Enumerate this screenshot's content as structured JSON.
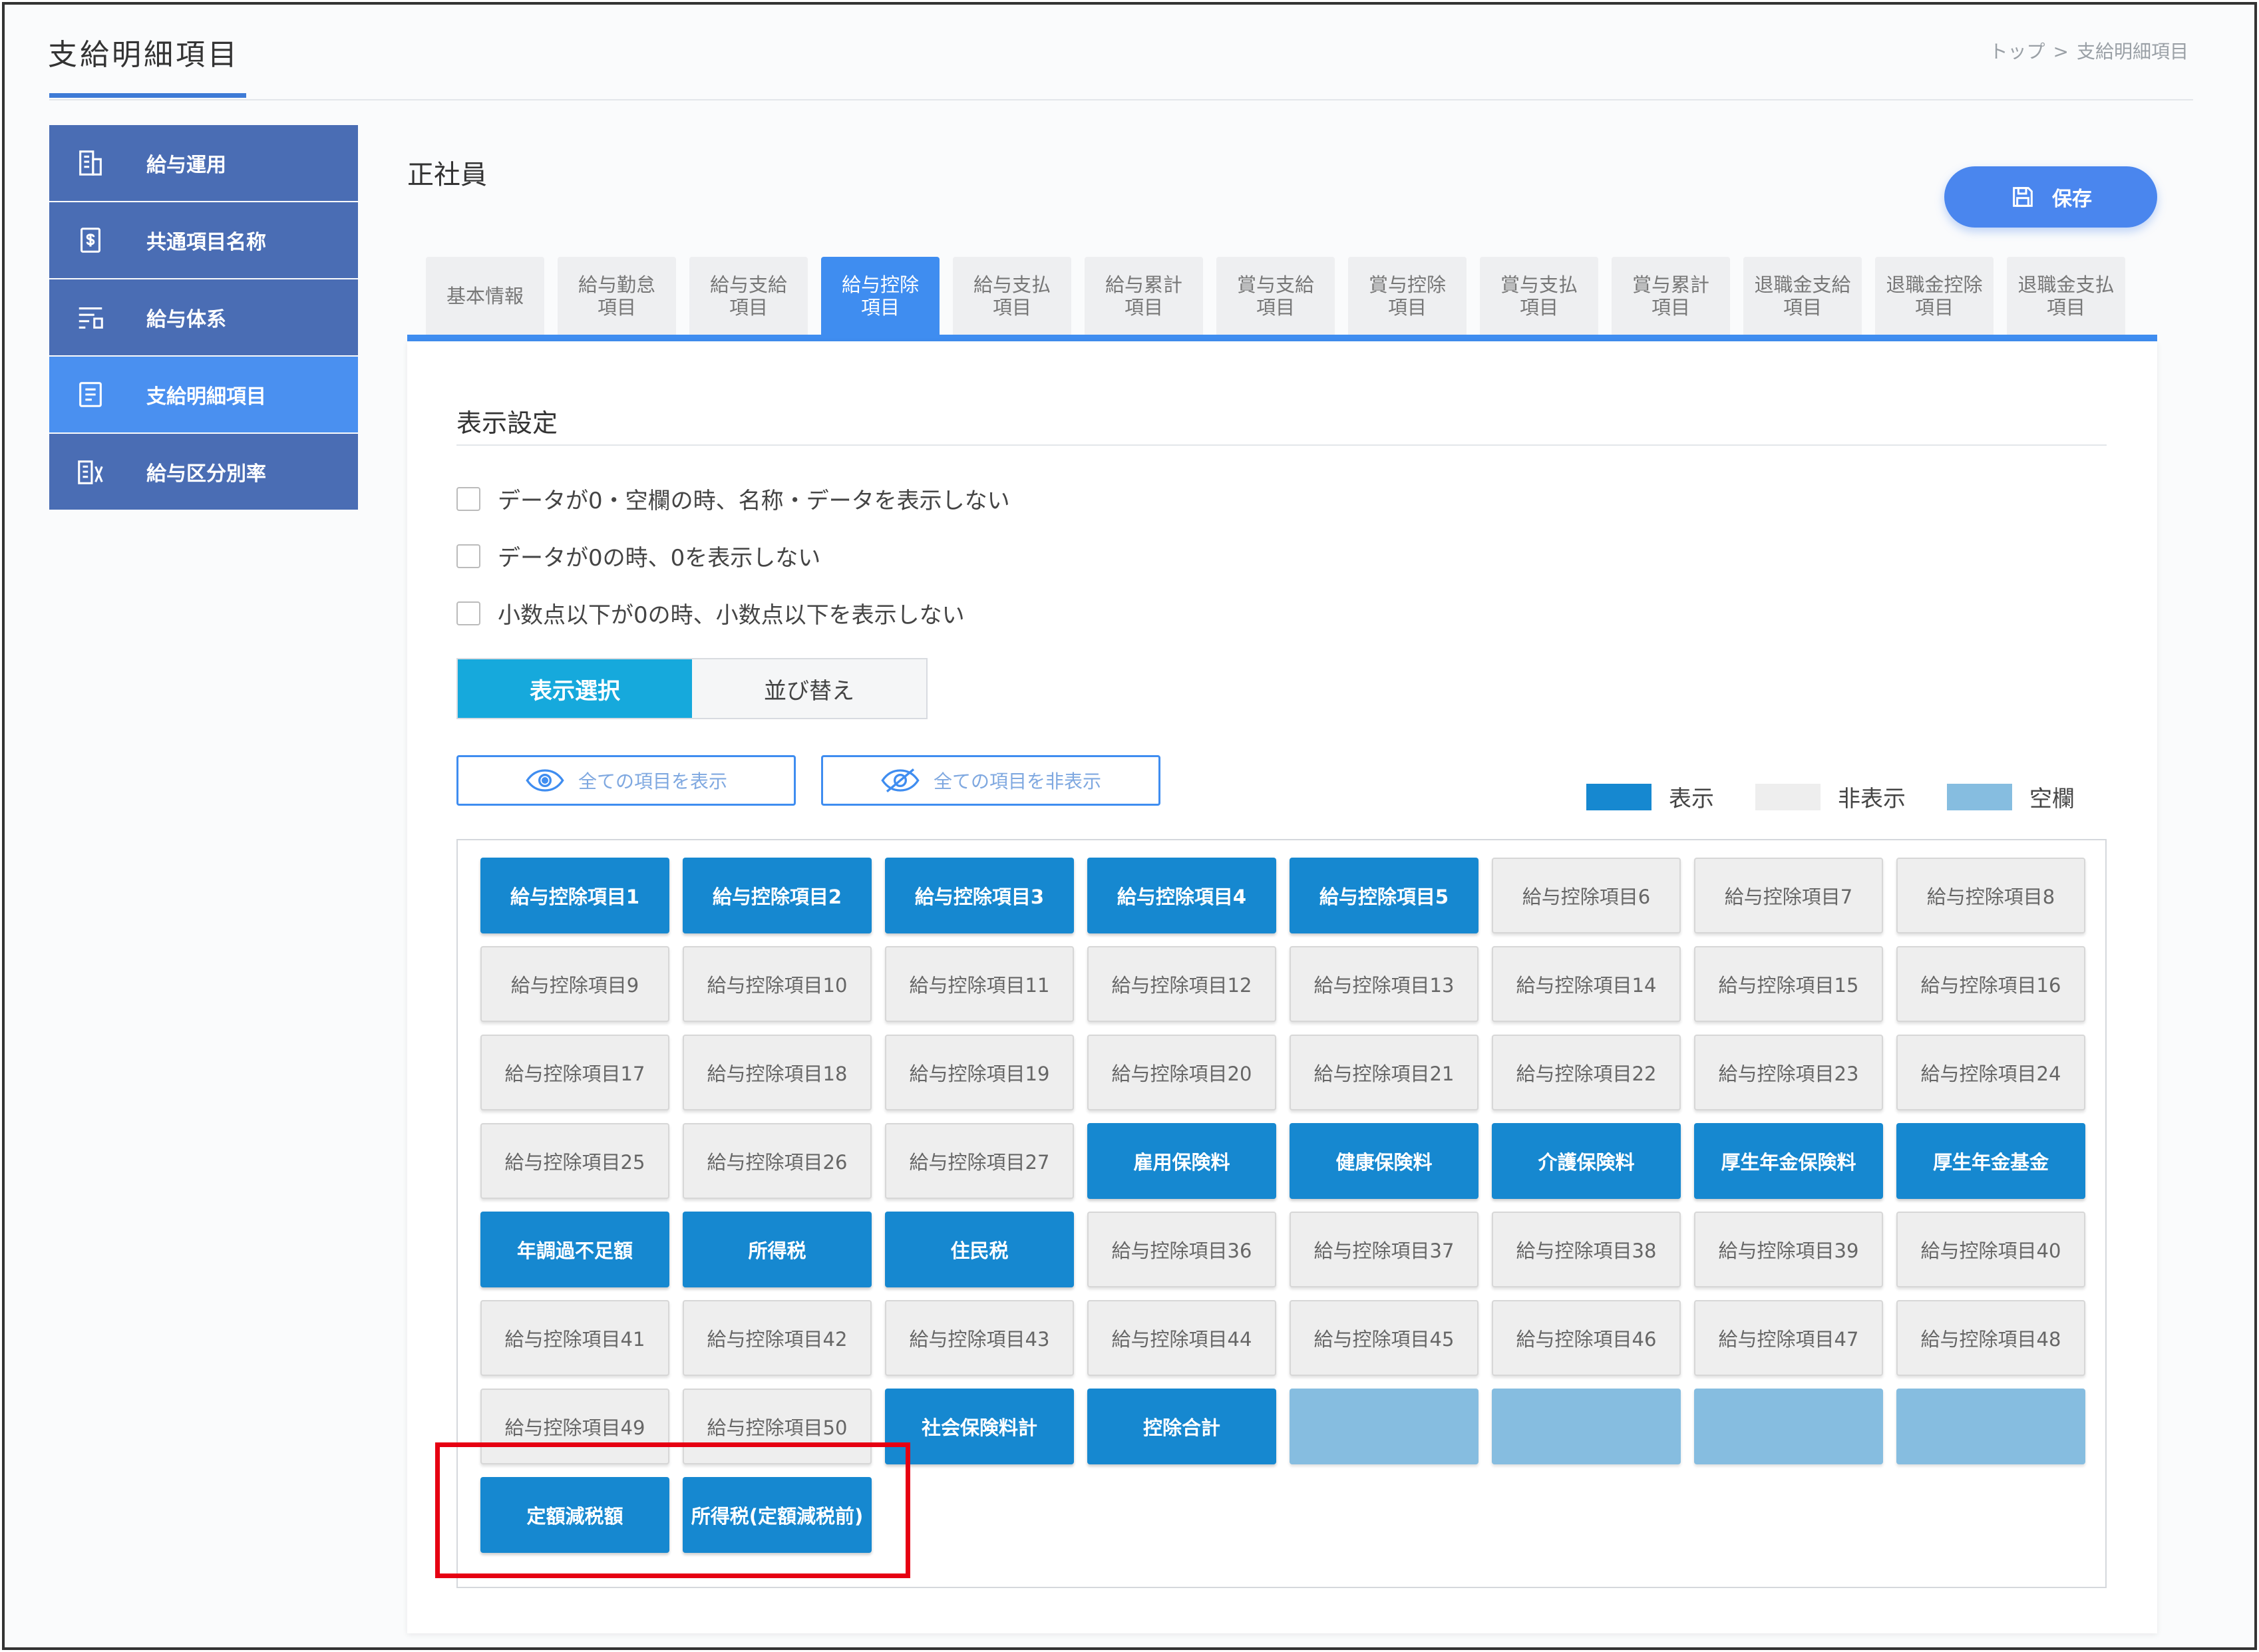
{
  "header": {
    "title": "支給明細項目",
    "breadcrumb": {
      "home": "トップ",
      "separator": ">",
      "current": "支給明細項目"
    }
  },
  "sidebar": {
    "items": [
      {
        "label": "給与運用",
        "icon": "building-icon"
      },
      {
        "label": "共通項目名称",
        "icon": "currency-document-icon"
      },
      {
        "label": "給与体系",
        "icon": "structure-icon"
      },
      {
        "label": "支給明細項目",
        "icon": "statement-icon",
        "active": true
      },
      {
        "label": "給与区分別率",
        "icon": "rate-building-icon"
      }
    ]
  },
  "main": {
    "employee_type": "正社員",
    "save_label": "保存",
    "tabs": [
      {
        "line1": "基本情報",
        "line2": ""
      },
      {
        "line1": "給与勤怠",
        "line2": "項目"
      },
      {
        "line1": "給与支給",
        "line2": "項目"
      },
      {
        "line1": "給与控除",
        "line2": "項目",
        "active": true
      },
      {
        "line1": "給与支払",
        "line2": "項目"
      },
      {
        "line1": "給与累計",
        "line2": "項目"
      },
      {
        "line1": "賞与支給",
        "line2": "項目"
      },
      {
        "line1": "賞与控除",
        "line2": "項目"
      },
      {
        "line1": "賞与支払",
        "line2": "項目"
      },
      {
        "line1": "賞与累計",
        "line2": "項目"
      },
      {
        "line1": "退職金支給",
        "line2": "項目"
      },
      {
        "line1": "退職金控除",
        "line2": "項目"
      },
      {
        "line1": "退職金支払",
        "line2": "項目"
      }
    ],
    "display_settings": {
      "title": "表示設定",
      "options": [
        {
          "label": "データが0・空欄の時、名称・データを表示しない",
          "checked": false
        },
        {
          "label": "データが0の時、0を表示しない",
          "checked": false
        },
        {
          "label": "小数点以下が0の時、小数点以下を表示しない",
          "checked": false
        }
      ]
    },
    "mode": {
      "select_label": "表示選択",
      "sort_label": "並び替え",
      "active": "表示選択"
    },
    "show_all_label": "全ての項目を表示",
    "hide_all_label": "全ての項目を非表示",
    "legend": [
      {
        "label": "表示",
        "color": "#1688d0"
      },
      {
        "label": "非表示",
        "color": "#eeeeee"
      },
      {
        "label": "空欄",
        "color": "#86bde0"
      }
    ],
    "items": [
      {
        "label": "給与控除項目1",
        "state": "show"
      },
      {
        "label": "給与控除項目2",
        "state": "show"
      },
      {
        "label": "給与控除項目3",
        "state": "show"
      },
      {
        "label": "給与控除項目4",
        "state": "show"
      },
      {
        "label": "給与控除項目5",
        "state": "show"
      },
      {
        "label": "給与控除項目6",
        "state": "hide"
      },
      {
        "label": "給与控除項目7",
        "state": "hide"
      },
      {
        "label": "給与控除項目8",
        "state": "hide"
      },
      {
        "label": "給与控除項目9",
        "state": "hide"
      },
      {
        "label": "給与控除項目10",
        "state": "hide"
      },
      {
        "label": "給与控除項目11",
        "state": "hide"
      },
      {
        "label": "給与控除項目12",
        "state": "hide"
      },
      {
        "label": "給与控除項目13",
        "state": "hide"
      },
      {
        "label": "給与控除項目14",
        "state": "hide"
      },
      {
        "label": "給与控除項目15",
        "state": "hide"
      },
      {
        "label": "給与控除項目16",
        "state": "hide"
      },
      {
        "label": "給与控除項目17",
        "state": "hide"
      },
      {
        "label": "給与控除項目18",
        "state": "hide"
      },
      {
        "label": "給与控除項目19",
        "state": "hide"
      },
      {
        "label": "給与控除項目20",
        "state": "hide"
      },
      {
        "label": "給与控除項目21",
        "state": "hide"
      },
      {
        "label": "給与控除項目22",
        "state": "hide"
      },
      {
        "label": "給与控除項目23",
        "state": "hide"
      },
      {
        "label": "給与控除項目24",
        "state": "hide"
      },
      {
        "label": "給与控除項目25",
        "state": "hide"
      },
      {
        "label": "給与控除項目26",
        "state": "hide"
      },
      {
        "label": "給与控除項目27",
        "state": "hide"
      },
      {
        "label": "雇用保険料",
        "state": "show"
      },
      {
        "label": "健康保険料",
        "state": "show"
      },
      {
        "label": "介護保険料",
        "state": "show"
      },
      {
        "label": "厚生年金保険料",
        "state": "show"
      },
      {
        "label": "厚生年金基金",
        "state": "show"
      },
      {
        "label": "年調過不足額",
        "state": "show"
      },
      {
        "label": "所得税",
        "state": "show"
      },
      {
        "label": "住民税",
        "state": "show"
      },
      {
        "label": "給与控除項目36",
        "state": "hide"
      },
      {
        "label": "給与控除項目37",
        "state": "hide"
      },
      {
        "label": "給与控除項目38",
        "state": "hide"
      },
      {
        "label": "給与控除項目39",
        "state": "hide"
      },
      {
        "label": "給与控除項目40",
        "state": "hide"
      },
      {
        "label": "給与控除項目41",
        "state": "hide"
      },
      {
        "label": "給与控除項目42",
        "state": "hide"
      },
      {
        "label": "給与控除項目43",
        "state": "hide"
      },
      {
        "label": "給与控除項目44",
        "state": "hide"
      },
      {
        "label": "給与控除項目45",
        "state": "hide"
      },
      {
        "label": "給与控除項目46",
        "state": "hide"
      },
      {
        "label": "給与控除項目47",
        "state": "hide"
      },
      {
        "label": "給与控除項目48",
        "state": "hide"
      },
      {
        "label": "給与控除項目49",
        "state": "hide"
      },
      {
        "label": "給与控除項目50",
        "state": "hide"
      },
      {
        "label": "社会保険料計",
        "state": "show"
      },
      {
        "label": "控除合計",
        "state": "show"
      },
      {
        "label": "",
        "state": "blank"
      },
      {
        "label": "",
        "state": "blank"
      },
      {
        "label": "",
        "state": "blank"
      },
      {
        "label": "",
        "state": "blank"
      },
      {
        "label": "定額減税額",
        "state": "show"
      },
      {
        "label": "所得税(定額減税前)",
        "state": "show"
      }
    ]
  }
}
